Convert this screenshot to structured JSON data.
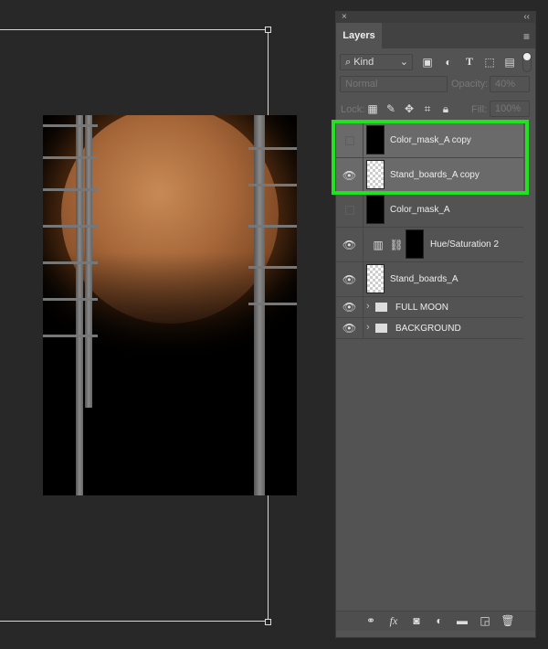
{
  "panel": {
    "close": "×",
    "collapse": "‹‹",
    "tab": "Layers",
    "menu_icon": "hamburger-icon",
    "filter": {
      "label": "Kind",
      "icons": [
        "image-filter-icon",
        "adjustment-filter-icon",
        "type-filter-icon",
        "shape-filter-icon",
        "smart-object-filter-icon"
      ]
    },
    "blend_mode": "Normal",
    "opacity_label": "Opacity:",
    "opacity": "40%",
    "lock_label": "Lock:",
    "fill_label": "Fill:",
    "fill": "100%"
  },
  "layers": [
    {
      "name": "Color_mask_A copy",
      "visible": false,
      "selected": true
    },
    {
      "name": "Stand_boards_A copy",
      "visible": true,
      "selected": true
    },
    {
      "name": "Color_mask_A",
      "visible": false,
      "selected": false
    },
    {
      "name": "Hue/Saturation 2",
      "visible": true,
      "selected": false
    },
    {
      "name": "Stand_boards_A",
      "visible": true,
      "selected": false
    },
    {
      "name": "FULL MOON",
      "visible": true,
      "group": true
    },
    {
      "name": "BACKGROUND",
      "visible": true,
      "group": true
    }
  ],
  "highlight_color": "#1ee31e",
  "footer_icons": [
    "link-icon",
    "fx-icon",
    "mask-icon",
    "adjustment-icon",
    "folder-icon",
    "new-layer-icon",
    "trash-icon"
  ]
}
